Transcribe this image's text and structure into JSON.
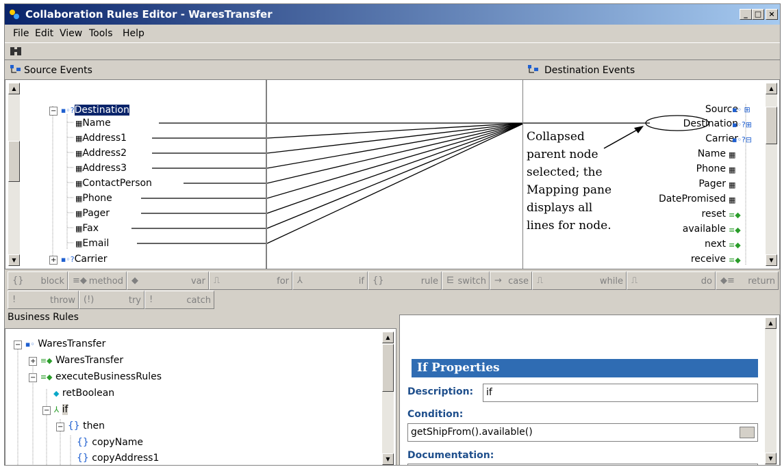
{
  "window": {
    "title": "Collaboration Rules Editor - WaresTransfer",
    "buttons": [
      "_",
      "□",
      "×"
    ]
  },
  "menu": [
    "File",
    "Edit",
    "View",
    "Tools",
    "Help"
  ],
  "toolbar": {
    "find_icon": "binoculars-icon"
  },
  "source_events": {
    "header": "Source Events",
    "tree": [
      {
        "label": "Destination",
        "icon": "structure-icon",
        "selected": true
      },
      {
        "label": "Name",
        "icon": "field-icon"
      },
      {
        "label": "Address1",
        "icon": "field-icon"
      },
      {
        "label": "Address2",
        "icon": "field-icon"
      },
      {
        "label": "Address3",
        "icon": "field-icon"
      },
      {
        "label": "ContactPerson",
        "icon": "repeat-field-icon"
      },
      {
        "label": "Phone",
        "icon": "repeat-field-icon"
      },
      {
        "label": "Pager",
        "icon": "field-icon"
      },
      {
        "label": "Fax",
        "icon": "repeat-field-icon"
      },
      {
        "label": "Email",
        "icon": "repeat-field-icon"
      },
      {
        "label": "Carrier",
        "icon": "structure-icon"
      }
    ]
  },
  "destination_events": {
    "header": "Destination Events",
    "tree": [
      {
        "label": "Source"
      },
      {
        "label": "Destination"
      },
      {
        "label": "Carrier"
      },
      {
        "label": "Name"
      },
      {
        "label": "Phone"
      },
      {
        "label": "Pager"
      },
      {
        "label": "DatePromised"
      },
      {
        "label": "reset"
      },
      {
        "label": "available"
      },
      {
        "label": "next"
      },
      {
        "label": "receive"
      }
    ]
  },
  "annotation": {
    "lines": [
      "Collapsed",
      "parent node",
      "selected; the",
      "Mapping pane",
      "displays all",
      "lines for node."
    ]
  },
  "palette": {
    "row1": [
      {
        "icon": "{}",
        "label": "block"
      },
      {
        "icon": "≡◆",
        "label": "method"
      },
      {
        "icon": "◆",
        "label": "var"
      },
      {
        "icon": "⎍",
        "label": "for"
      },
      {
        "icon": "⅄",
        "label": "if"
      },
      {
        "icon": "{}",
        "label": "rule"
      },
      {
        "icon": "⋿",
        "label": "switch"
      },
      {
        "icon": "→",
        "label": "case"
      },
      {
        "icon": "⎍",
        "label": "while"
      },
      {
        "icon": "⎍",
        "label": "do"
      },
      {
        "icon": "◆≡",
        "label": "return"
      }
    ],
    "row2": [
      {
        "icon": "!",
        "label": "throw"
      },
      {
        "icon": "(!)",
        "label": "try"
      },
      {
        "icon": "!",
        "label": "catch"
      }
    ]
  },
  "business_rules": {
    "header": "Business Rules",
    "tree": [
      {
        "label": "WaresTransfer"
      },
      {
        "label": "WaresTransfer"
      },
      {
        "label": "executeBusinessRules"
      },
      {
        "label": "retBoolean"
      },
      {
        "label": "if"
      },
      {
        "label": "then"
      },
      {
        "label": "copyName"
      },
      {
        "label": "copyAddress1"
      }
    ]
  },
  "properties": {
    "title": "If Properties",
    "description_label": "Description:",
    "description_value": "if",
    "condition_label": "Condition:",
    "condition_value": "getShipFrom().available()",
    "documentation_label": "Documentation:"
  },
  "colors": {
    "titlebar": "#0a246a",
    "props_title": "#2f6cb3",
    "label_blue": "#1f4f8c"
  }
}
